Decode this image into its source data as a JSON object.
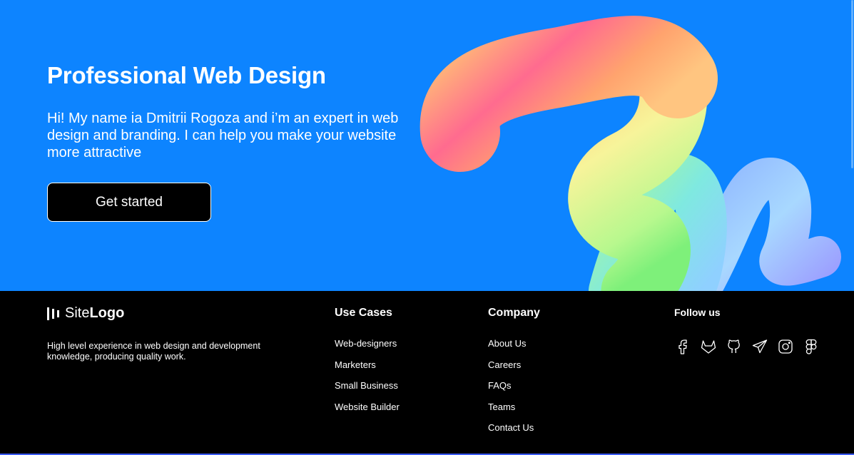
{
  "hero": {
    "title": "Professional Web Design",
    "description": "Hi! My name ia Dmitrii Rogoza and i’m an expert in web design and branding. I can help you make your website more attractive",
    "cta_label": "Get started",
    "background_color": "#0d84ff"
  },
  "footer": {
    "brand": {
      "site": "Site",
      "logo": "Logo"
    },
    "description": "High level experience in web design and development knowledge, producing quality work.",
    "use_cases": {
      "title": "Use Cases",
      "items": [
        "Web-designers",
        "Marketers",
        "Small Business",
        "Website Builder"
      ]
    },
    "company": {
      "title": "Company",
      "items": [
        "About Us",
        "Careers",
        "FAQs",
        "Teams",
        "Contact Us"
      ]
    },
    "follow": {
      "title": "Follow us",
      "icons": [
        "facebook-icon",
        "gitlab-icon",
        "github-icon",
        "telegram-icon",
        "instagram-icon",
        "figma-icon"
      ]
    }
  }
}
